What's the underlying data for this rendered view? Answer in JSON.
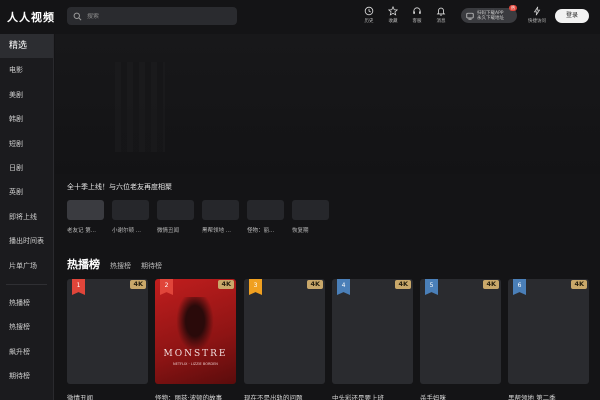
{
  "app": {
    "logo": "人人视频"
  },
  "search": {
    "placeholder": "搜索"
  },
  "header_icons": [
    {
      "label": "历史",
      "icon": "history-icon"
    },
    {
      "label": "收藏",
      "icon": "star-icon"
    },
    {
      "label": "客服",
      "icon": "headset-icon"
    },
    {
      "label": "消息",
      "icon": "bell-icon"
    }
  ],
  "app_download": {
    "line1": "扫码下载APP",
    "line2": "永久下载地址",
    "badge": "热"
  },
  "quick_access": {
    "label": "快捷访问"
  },
  "login": {
    "label": "登录"
  },
  "sidebar": {
    "items": [
      "精选",
      "电影",
      "美剧",
      "韩剧",
      "短剧",
      "日剧",
      "英剧",
      "即将上线",
      "播出时间表",
      "片单广场"
    ],
    "ranks": [
      "热播榜",
      "热搜榜",
      "飙升榜",
      "期待榜"
    ]
  },
  "banner": {
    "title": "全十季上线！与六位老友再度相聚"
  },
  "thumbs": [
    "老友记 第...",
    "小谢尔顿 ...",
    "微情丑闻",
    "黑帮领地 ...",
    "怪物：丽...",
    "恢复期"
  ],
  "rank_tabs": {
    "title": "热播榜",
    "tab2": "热搜榜",
    "tab3": "期待榜"
  },
  "cards": [
    {
      "rank": "1",
      "quality": "4K",
      "name": "微情丑闻",
      "rank_color": "#e0453a"
    },
    {
      "rank": "2",
      "quality": "4K",
      "name": "怪物：丽兹·波顿的故事",
      "rank_color": "#e0453a",
      "poster_title": "MONSTRE",
      "poster_sub": "NETFLIX · LIZZIE BORDEN"
    },
    {
      "rank": "3",
      "quality": "4K",
      "name": "现在不是出轨的问题",
      "rank_color": "#f0a020"
    },
    {
      "rank": "4",
      "quality": "4K",
      "name": "中头彩还是要上班",
      "rank_color": "#4a7fb8"
    },
    {
      "rank": "5",
      "quality": "4K",
      "name": "杀手妈咪",
      "rank_color": "#4a7fb8"
    },
    {
      "rank": "6",
      "quality": "4K",
      "name": "黑帮领地 第二季",
      "rank_color": "#4a7fb8"
    }
  ]
}
